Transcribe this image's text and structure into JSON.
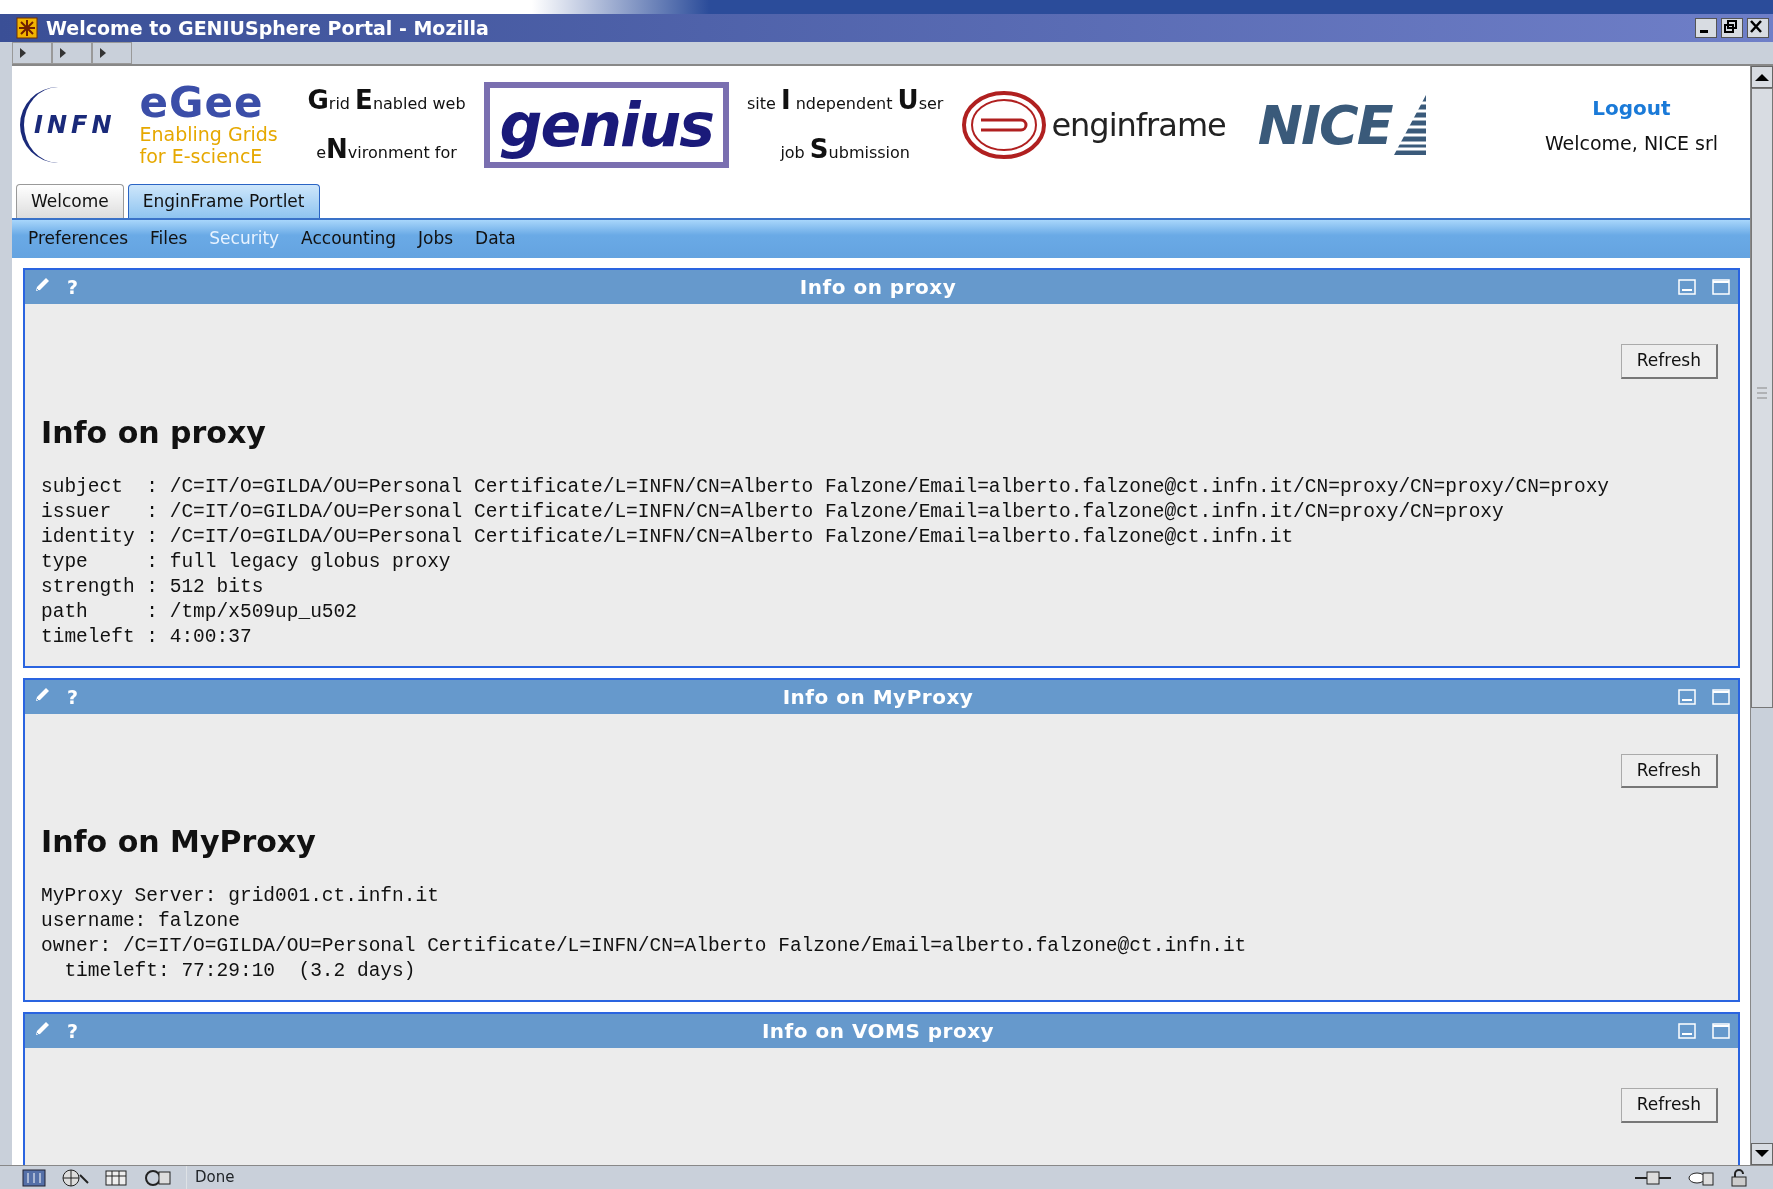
{
  "window": {
    "title": "Welcome to GENIUSphere Portal - Mozilla"
  },
  "header": {
    "infn_logo": "INFN",
    "egee_logo": "eGee",
    "egee_tagline": "Enabling Grids for E-sciencE",
    "acronym_left": [
      "**G**rid **E**nabled web",
      "e**N**vironment for"
    ],
    "genius_logo": "genius",
    "acronym_right": [
      "site **I** ndependent **U**ser",
      "job **S**ubmission"
    ],
    "enginframe_logo": "enginframe",
    "nice_logo": "NICE",
    "logout": "Logout",
    "welcome": "Welcome, NICE srl"
  },
  "tabs": [
    {
      "label": "Welcome",
      "selected": false
    },
    {
      "label": "EnginFrame Portlet",
      "selected": true
    }
  ],
  "menu": [
    {
      "label": "Preferences",
      "selected": false
    },
    {
      "label": "Files",
      "selected": false
    },
    {
      "label": "Security",
      "selected": true
    },
    {
      "label": "Accounting",
      "selected": false
    },
    {
      "label": "Jobs",
      "selected": false
    },
    {
      "label": "Data",
      "selected": false
    }
  ],
  "panels": [
    {
      "title": "Info on proxy",
      "help": "?",
      "button": "Refresh",
      "heading": "Info on proxy",
      "lines": [
        "subject  : /C=IT/O=GILDA/OU=Personal Certificate/L=INFN/CN=Alberto Falzone/Email=alberto.falzone@ct.infn.it/CN=proxy/CN=proxy/CN=proxy",
        "issuer   : /C=IT/O=GILDA/OU=Personal Certificate/L=INFN/CN=Alberto Falzone/Email=alberto.falzone@ct.infn.it/CN=proxy/CN=proxy",
        "identity : /C=IT/O=GILDA/OU=Personal Certificate/L=INFN/CN=Alberto Falzone/Email=alberto.falzone@ct.infn.it",
        "type     : full legacy globus proxy",
        "strength : 512 bits",
        "path     : /tmp/x509up_u502",
        "timeleft : 4:00:37"
      ]
    },
    {
      "title": "Info on MyProxy",
      "help": "?",
      "button": "Refresh",
      "heading": "Info on MyProxy",
      "lines": [
        "MyProxy Server: grid001.ct.infn.it",
        "username: falzone",
        "owner: /C=IT/O=GILDA/OU=Personal Certificate/L=INFN/CN=Alberto Falzone/Email=alberto.falzone@ct.infn.it",
        "  timeleft: 77:29:10  (3.2 days)"
      ]
    },
    {
      "title": "Info on VOMS proxy",
      "help": "?",
      "button": "Refresh"
    }
  ],
  "status_bar": {
    "text": "Done"
  }
}
